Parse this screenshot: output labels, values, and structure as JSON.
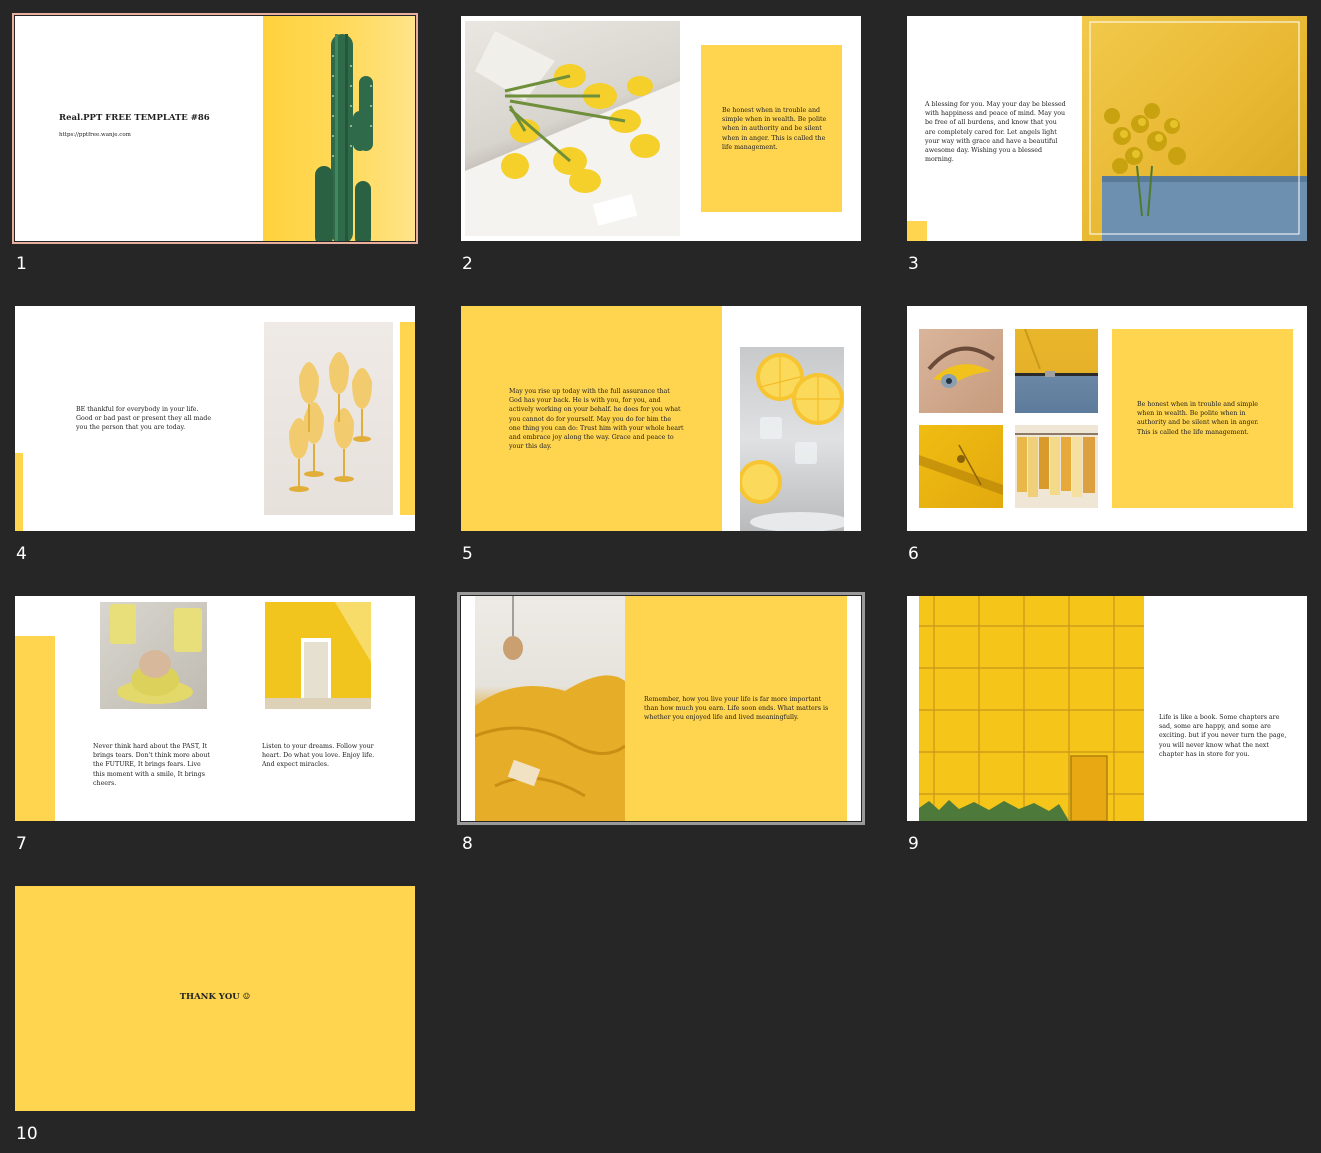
{
  "colors": {
    "background": "#262626",
    "accent": "#ffd54f",
    "selected_border": "#e8b09c"
  },
  "slides": [
    {
      "number": "1",
      "title": "Real.PPT FREE TEMPLATE #86",
      "subtitle": "https://pptfree.wanje.com",
      "selected": true
    },
    {
      "number": "2",
      "body": "Be honest when in trouble and simple when in wealth. Be polite when in authority and be silent when in anger. This is called the life management."
    },
    {
      "number": "3",
      "body": "A blessing for you. May your day be blessed with happiness and peace of mind. May you be free of all burdens, and know that you are completely cared for. Let angels light your way with grace and have a beautiful awesome day. Wishing you a blessed morning."
    },
    {
      "number": "4",
      "body": "BE thankful for everybody in your life. Good or bad past or present they all made you the person that you are today."
    },
    {
      "number": "5",
      "body": "May you rise up today with the full assurance that God has your back. He is with you, for you, and actively working on your behalf. he does for you what you cannot do for yourself. May you do for him the one thing you can do: Trust him with your whole heart and embrace joy along the way. Grace and peace to your this day."
    },
    {
      "number": "6",
      "body": "Be honest when in trouble and simple when in wealth. Be polite when in authority and be silent when in anger. This is called the life management."
    },
    {
      "number": "7",
      "body_left": "Never think hard about the PAST, It brings tears. Don't think more about the FUTURE, It brings fears. Live this moment with a smile, It brings cheers.",
      "body_right": "Listen to your dreams. Follow your heart. Do what you love. Enjoy life. And expect miracles."
    },
    {
      "number": "8",
      "body": "Remember, how you live your life is far more important than how much you earn. Life soon ends. What matters is whether you enjoyed life and lived meaningfully.",
      "hovered": true
    },
    {
      "number": "9",
      "body": "Life is like a book. Some chapters are sad, some are happy, and some are exciting. but if you never turn the page, you will never know what the next chapter has in store for you."
    },
    {
      "number": "10",
      "title": "THANK YOU ☺"
    }
  ]
}
